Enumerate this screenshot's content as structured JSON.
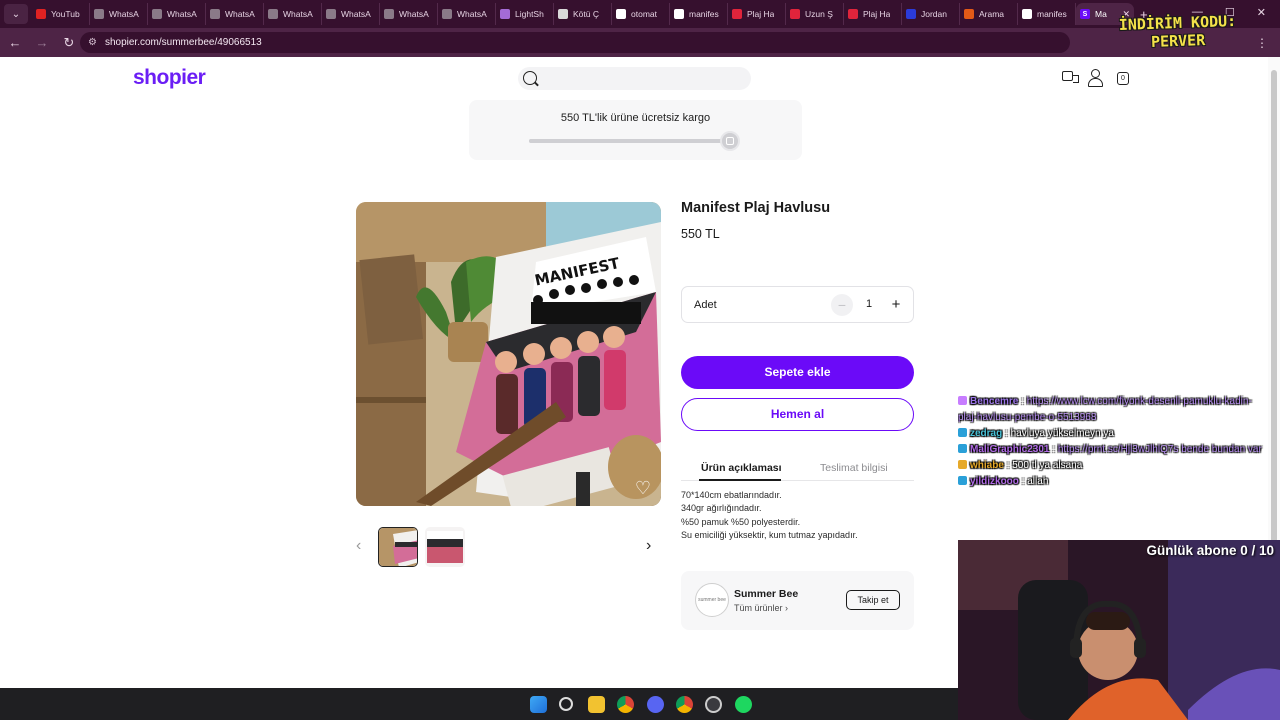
{
  "browser": {
    "tabs": [
      {
        "label": "YouTub",
        "favicon": "youtube-icon",
        "color": "#e02222"
      },
      {
        "label": "WhatsA",
        "favicon": "globe-icon",
        "color": "#8a7a88"
      },
      {
        "label": "WhatsA",
        "favicon": "globe-icon",
        "color": "#8a7a88"
      },
      {
        "label": "WhatsA",
        "favicon": "globe-icon",
        "color": "#8a7a88"
      },
      {
        "label": "WhatsA",
        "favicon": "globe-icon",
        "color": "#8a7a88"
      },
      {
        "label": "WhatsA",
        "favicon": "globe-icon",
        "color": "#8a7a88"
      },
      {
        "label": "WhatsA",
        "favicon": "globe-icon",
        "color": "#8a7a88"
      },
      {
        "label": "WhatsA",
        "favicon": "globe-icon",
        "color": "#8a7a88"
      },
      {
        "label": "LightSh",
        "favicon": "feather-icon",
        "color": "#a46bd6"
      },
      {
        "label": "Kötü Ç",
        "favicon": "image-icon",
        "color": "#d9d9d9"
      },
      {
        "label": "otomat",
        "favicon": "google-icon",
        "color": "#ffffff"
      },
      {
        "label": "manifes",
        "favicon": "google-icon",
        "color": "#ffffff"
      },
      {
        "label": "Plaj Ha",
        "favicon": "bookmark-icon",
        "color": "#e0243b"
      },
      {
        "label": "Uzun Ş",
        "favicon": "bookmark-icon",
        "color": "#e0243b"
      },
      {
        "label": "Plaj Ha",
        "favicon": "bookmark-icon",
        "color": "#e0243b"
      },
      {
        "label": "Jordan",
        "favicon": "brand-icon",
        "color": "#2b3bd9"
      },
      {
        "label": "Arama",
        "favicon": "brand-icon",
        "color": "#e35a17"
      },
      {
        "label": "manifes",
        "favicon": "google-icon",
        "color": "#ffffff"
      }
    ],
    "active_tab": {
      "label": "Ma",
      "favicon": "S",
      "color": "#6b0af8"
    },
    "url": "shopier.com/summerbee/49066513"
  },
  "overlay_code": {
    "line1": "İNDİRİM KODU:",
    "line2": "PERVER"
  },
  "header": {
    "logo": "shopier",
    "search_placeholder": ""
  },
  "shipping": {
    "text": "550 TL'lik ürüne ücretsiz kargo",
    "progress": 1.0
  },
  "product": {
    "title": "Manifest Plaj Havlusu",
    "price": "550 TL",
    "qty_label": "Adet",
    "qty": "1",
    "add_to_cart": "Sepete ekle",
    "buy_now": "Hemen al",
    "tabs": [
      "Ürün açıklaması",
      "Teslimat bilgisi"
    ],
    "description": [
      "70*140cm ebatlarındadır.",
      "340gr ağırlığındadır.",
      "%50 pamuk %50 polyesterdir.",
      "Su emiciliği yüksektir, kum tutmaz yapıdadır."
    ]
  },
  "seller": {
    "name": "Summer Bee",
    "all_products": "Tüm ürünler",
    "follow": "Takip et"
  },
  "chat": [
    {
      "user": "Bencemre",
      "sep": ":",
      "msg": "https://www.lcw.com/fiyonk-desenli-pamuklu-kadin-plaj-havlusu-pembe-o-5513968",
      "ucolor": "#9b74e8",
      "mcolor": "#b48af0"
    },
    {
      "user": "zedrag",
      "sep": ":",
      "msg": "havluya yükselmeyn ya",
      "ucolor": "#47c2d8",
      "mcolor": "#ffffff"
    },
    {
      "user": "MaliGraphic2301",
      "sep": ":",
      "msg": "https://prnt.sc/Hjl3wJlhlQ7s bende bundan var",
      "ucolor": "#b06ae6",
      "mcolor": "#b48af0"
    },
    {
      "user": "whiabe",
      "sep": ":",
      "msg": "500 tl ya alsana",
      "ucolor": "#e6a92a",
      "mcolor": "#ffffff"
    },
    {
      "user": "yildizkooo",
      "sep": ":",
      "msg": "allah",
      "ucolor": "#b06ae6",
      "mcolor": "#ffffff"
    }
  ],
  "cam": {
    "label": "Günlük abone 0 / 10"
  }
}
